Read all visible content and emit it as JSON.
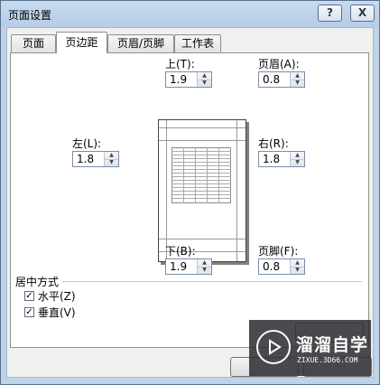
{
  "window": {
    "title": "页面设置",
    "help_label": "?",
    "close_label": "X"
  },
  "tabs": [
    {
      "label": "页面"
    },
    {
      "label": "页边距"
    },
    {
      "label": "页眉/页脚"
    },
    {
      "label": "工作表"
    }
  ],
  "margins": {
    "top": {
      "label": "上(T):",
      "value": "1.9"
    },
    "header": {
      "label": "页眉(A):",
      "value": "0.8"
    },
    "left": {
      "label": "左(L):",
      "value": "1.8"
    },
    "right": {
      "label": "右(R):",
      "value": "1.8"
    },
    "bottom": {
      "label": "下(B):",
      "value": "1.9"
    },
    "footer": {
      "label": "页脚(F):",
      "value": "0.8"
    }
  },
  "center_on_page": {
    "title": "居中方式",
    "horizontal": {
      "label": "水平(Z)",
      "checked": true
    },
    "vertical": {
      "label": "垂直(V)",
      "checked": true
    }
  },
  "watermark": {
    "title": "溜溜自学",
    "url": "ZIXUE.3D66.COM"
  },
  "colors": {
    "frame": "#bdd3ea",
    "client": "#f0f0f0",
    "watermark_bg": "#2c2c32"
  }
}
